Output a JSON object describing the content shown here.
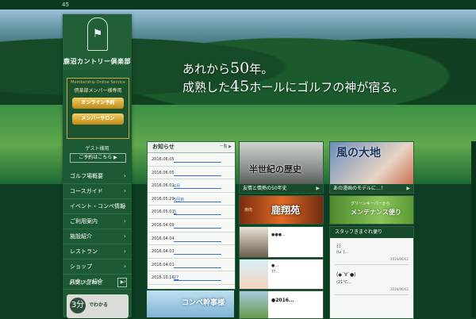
{
  "topbar": {
    "counter": "45"
  },
  "hero": {
    "line1_pre": "あれから",
    "line1_big": "50",
    "line1_post": "年。",
    "line2_pre": "成熟した",
    "line2_big": "45",
    "line2_post": "ホールにゴルフの神が宿る。"
  },
  "logo": {
    "name": "鹿沼カントリー倶楽部"
  },
  "member": {
    "caption": "Membership Online Service",
    "heading": "倶楽部メンバー様専用",
    "online_booking": "オンライン予約",
    "member_salon": "メンバーサロン"
  },
  "guest": {
    "label": "ゲスト様用",
    "booking": "ご予約はこちら ▶"
  },
  "nav": {
    "items": [
      {
        "label": "ゴルフ場概要"
      },
      {
        "label": "コースガイド"
      },
      {
        "label": "イベント・コンペ情報"
      },
      {
        "label": "ご利用案内"
      },
      {
        "label": "施設紹介"
      },
      {
        "label": "レストラン"
      },
      {
        "label": "ショップ"
      },
      {
        "label": "スタッフ紹介"
      }
    ],
    "chevron": "›"
  },
  "sidebar_news": {
    "label": "お問い合わせ",
    "arrow": "▶"
  },
  "banner3": {
    "num": "3分",
    "text": "でわかる"
  },
  "news": {
    "title": "お知らせ",
    "more": "一覧 ▶",
    "rows": [
      {
        "date": "2016.06.05",
        "link": ""
      },
      {
        "date": "2016.06.05",
        "link": ""
      },
      {
        "date": "2016.06.01",
        "link": "6月"
      },
      {
        "date": "2016.05.29",
        "link": "5回目"
      },
      {
        "date": "2016.05.01",
        "link": "5"
      },
      {
        "date": "2016.04.09",
        "link": ""
      },
      {
        "date": "2016.04.04",
        "link": ""
      },
      {
        "date": "2016.04.03",
        "link": ""
      },
      {
        "date": "2016.04.01",
        "link": ""
      },
      {
        "date": "2015.10.16",
        "link": "27"
      }
    ]
  },
  "cards": {
    "history_title": "半世紀の歴史",
    "history_caption": "友情と情熱の50年史",
    "kaze_title": "風の大地",
    "kaze_caption": "あの漫画のモデルに…！",
    "rest_sub": "焼肉",
    "rest_title": "鹿翔苑",
    "maint_sub": "グリーンキーパーから",
    "maint_title": "メンテナンス便り",
    "arrow": "▶"
  },
  "photos": {
    "p1_text": "●●●...",
    "p2_text": "●...",
    "p2_text2": "??...",
    "p3_text": "●2016..."
  },
  "staff": {
    "title": "スタッフきまぐれ便り",
    "e1": "ﾐﾐ",
    "e1b": "(ω`)...",
    "d1": "2016/06/02",
    "e2": "(◆´∀`●)",
    "e2b": "(21℃...",
    "d2": "2016/06/02"
  },
  "compe": {
    "title": "コンペ幹事様"
  },
  "colors": {
    "brand_green": "#1c5a33",
    "gold": "#c08a18"
  }
}
